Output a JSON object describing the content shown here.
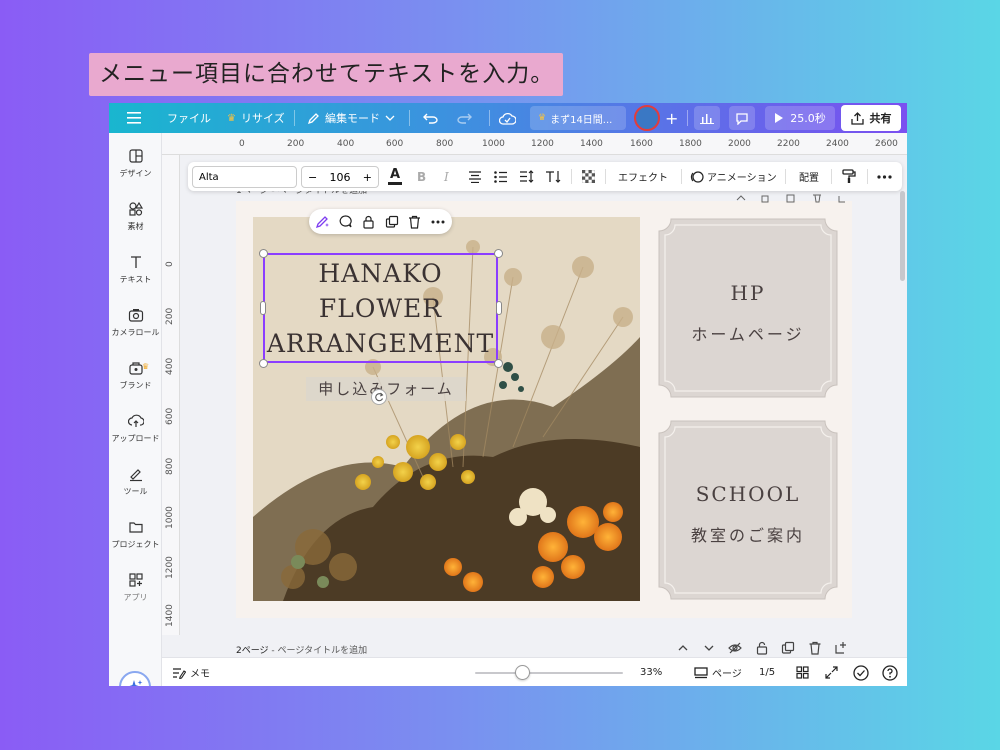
{
  "caption": "メニュー項目に合わせてテキストを入力。",
  "topbar": {
    "menu_icon": "hamburger-icon",
    "file": "ファイル",
    "resize": "リサイズ",
    "edit_mode": "編集モード",
    "trial": "まず14日間...",
    "play_time": "25.0秒",
    "share": "共有"
  },
  "sidebar": {
    "items": [
      {
        "label": "デザイン",
        "icon": "design-icon"
      },
      {
        "label": "素材",
        "icon": "elements-icon"
      },
      {
        "label": "テキスト",
        "icon": "text-icon"
      },
      {
        "label": "カメラロール",
        "icon": "camera-icon"
      },
      {
        "label": "ブランド",
        "icon": "brand-icon"
      },
      {
        "label": "アップロード",
        "icon": "upload-icon"
      },
      {
        "label": "ツール",
        "icon": "tools-icon"
      },
      {
        "label": "プロジェクト",
        "icon": "folder-icon"
      },
      {
        "label": "アプリ",
        "icon": "apps-icon"
      }
    ]
  },
  "ruler_top": [
    "0",
    "200",
    "400",
    "600",
    "800",
    "1000",
    "1200",
    "1400",
    "1600",
    "1800",
    "2000",
    "2200",
    "2400",
    "2600"
  ],
  "ruler_left": [
    "0",
    "200",
    "400",
    "600",
    "800",
    "1000",
    "1200",
    "1400",
    "1600"
  ],
  "text_toolbar": {
    "font": "Alta",
    "minus": "−",
    "size": "106",
    "plus": "+",
    "color_letter": "A",
    "bold": "B",
    "italic": "I",
    "effects": "エフェクト",
    "animation": "アニメーション",
    "position": "配置"
  },
  "page1_title": "1ページ - ページタイトルを追加",
  "canvas": {
    "title_lines": [
      "HANAKO",
      "FLOWER",
      "ARRANGEMENT"
    ],
    "form_label": "申し込みフォーム",
    "card1_en": "HP",
    "card1_jp": "ホームページ",
    "card2_en": "SCHOOL",
    "card2_jp": "教室のご案内"
  },
  "page2": {
    "label_prefix": "2ページ",
    "label_suffix": " - ページタイトルを追加"
  },
  "bottombar": {
    "notes": "メモ",
    "zoom": "33%",
    "pages": "ページ",
    "page_count": "1/5"
  },
  "colors": {
    "accent": "#8b3dff",
    "card_fill": "#dcd6d2",
    "card_text": "#4a4141"
  }
}
